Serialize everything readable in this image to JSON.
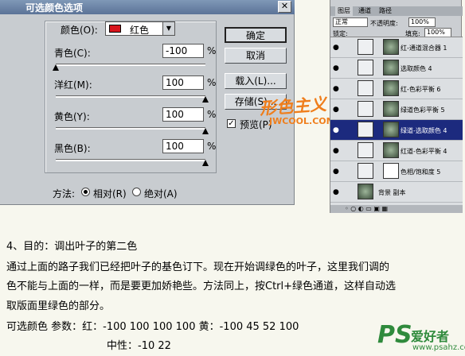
{
  "dialog": {
    "title": "可选颜色选项",
    "close_glyph": "✕",
    "colors_label": "颜色(O):",
    "color_value": "红色",
    "swatch_color": "#d8141c",
    "sliders": [
      {
        "label": "青色(C):",
        "value": "-100",
        "unit": "%",
        "level": 0.0
      },
      {
        "label": "洋红(M):",
        "value": "100",
        "unit": "%",
        "level": 1.0
      },
      {
        "label": "黄色(Y):",
        "value": "100",
        "unit": "%",
        "level": 1.0
      },
      {
        "label": "黑色(B):",
        "value": "100",
        "unit": "%",
        "level": 1.0
      }
    ],
    "buttons": {
      "ok": "确定",
      "cancel": "取消",
      "load": "载入(L)...",
      "save": "存储(S)..."
    },
    "preview_label": "预览(P)",
    "preview_checked": true,
    "method_label": "方法:",
    "relative_label": "相对(R)",
    "absolute_label": "绝对(A)"
  },
  "watermark": {
    "brand": "形色主义",
    "url": "JWCOOL.COM"
  },
  "layers_panel": {
    "tabs": [
      "图层",
      "通道",
      "路径"
    ],
    "blend_mode": "正常",
    "opacity_label": "不透明度:",
    "opacity_value": "100%",
    "lock_label": "锁定:",
    "fill_label": "填充:",
    "fill_value": "100%",
    "layers": [
      {
        "name": "红-通道混合器 1",
        "selected": false
      },
      {
        "name": "选取颜色 4",
        "selected": false
      },
      {
        "name": "红-色彩平衡 6",
        "selected": false
      },
      {
        "name": "绿道色彩平衡 5",
        "selected": false
      },
      {
        "name": "绿道-选取颜色 4",
        "selected": true
      },
      {
        "name": "红道-色彩平衡 4",
        "selected": false
      },
      {
        "name": "色相/饱和度 5",
        "selected": false
      },
      {
        "name": "背景 副本",
        "selected": false
      }
    ],
    "footer_glyphs": "◦ ○ ◐ ▭ ▣ ▦"
  },
  "article": {
    "heading": "4、目的：调出叶子的第二色",
    "para_line1": "通过上面的路子我们已经把叶子的基色订下。现在开始调绿色的叶子，这里我们调的",
    "para_line2": "色不能与上面的一样，而是要更加娇艳些。方法同上，按Ctrl+绿色通道，这样自动选",
    "para_line3": "取版面里绿色的部分。",
    "params_line": "可选颜色   参数：红：-100   100   100   100       黄：-100   45   52   100",
    "neutral_line": "中性：-10   22"
  },
  "logo": {
    "ps": "PS",
    "cn": "爱好者",
    "url": "www.psahz.com"
  }
}
